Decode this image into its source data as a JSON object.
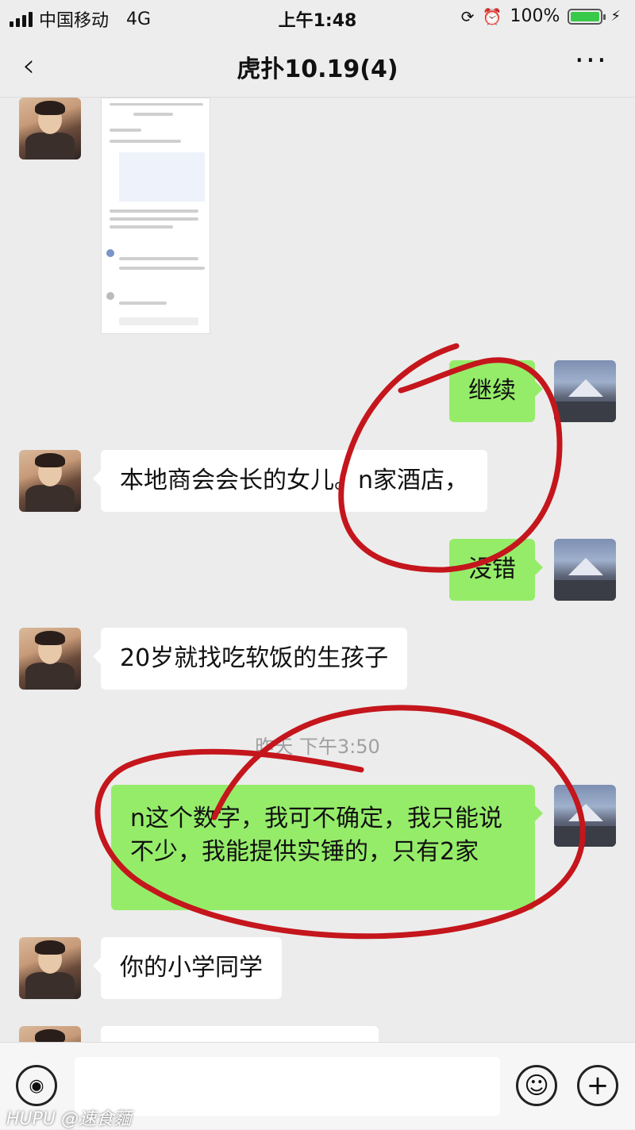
{
  "status_bar": {
    "carrier": "中国移动",
    "network": "4G",
    "time": "上午1:48",
    "battery": "100%"
  },
  "nav": {
    "title": "虎扑10.19(4)"
  },
  "messages": [
    {
      "side": "left",
      "type": "image"
    },
    {
      "side": "right",
      "type": "text",
      "text": "继续"
    },
    {
      "side": "left",
      "type": "text",
      "text": "本地商会会长的女儿。n家酒店，"
    },
    {
      "side": "right",
      "type": "text",
      "text": "没错"
    },
    {
      "side": "left",
      "type": "text",
      "text": "20岁就找吃软饭的生孩子"
    },
    {
      "side": "right",
      "type": "text",
      "text": "n这个数字，我可不确定，我只能说不少，我能提供实锤的，只有2家"
    },
    {
      "side": "left",
      "type": "text",
      "text": "你的小学同学"
    }
  ],
  "timestamp": "昨天 下午3:50",
  "watermark": "HUPU @速食麵",
  "colors": {
    "background": "#ececec",
    "incoming_bubble": "#ffffff",
    "outgoing_bubble": "#95ec69",
    "annotation_ink": "#c4161c"
  },
  "icons": [
    "signal-icon",
    "back-icon",
    "more-icon",
    "voice-icon",
    "emoji-icon",
    "plus-icon",
    "alarm-icon",
    "lock-rotation-icon",
    "battery-icon",
    "charging-icon"
  ]
}
